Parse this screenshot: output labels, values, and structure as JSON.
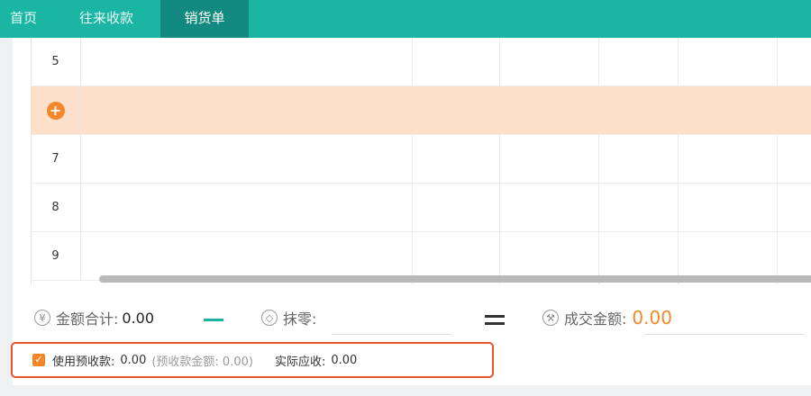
{
  "tabs": [
    "首页",
    "往来收款",
    "销货单"
  ],
  "grid": {
    "rows": [
      "5",
      "",
      "7",
      "8",
      "9"
    ]
  },
  "summary": {
    "total_label": "金额合计:",
    "total_value": "0.00",
    "rounding_label": "抹零:",
    "deal_label": "成交金额:",
    "deal_value": "0.00",
    "yen_icon": "¥"
  },
  "prepay": {
    "label": "使用预收款:",
    "value": "0.00",
    "note": "(预收款金额: 0.00)",
    "actual_label": "实际应收:",
    "actual_value": "0.00"
  },
  "colors": {
    "accent": "#1ab5a3",
    "orange": "#f5872a",
    "highlight": "#fde0cc"
  }
}
